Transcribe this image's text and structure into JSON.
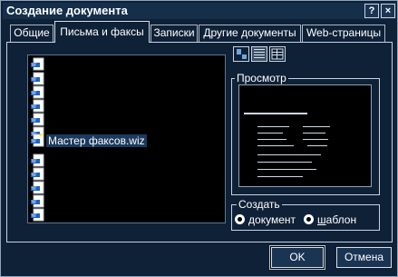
{
  "window": {
    "title": "Создание документа",
    "help_label": "?",
    "close_label": "×"
  },
  "tabs": [
    {
      "label": "Общие"
    },
    {
      "label": "Письма и факсы"
    },
    {
      "label": "Записки"
    },
    {
      "label": "Другие документы"
    },
    {
      "label": "Web-страницы"
    }
  ],
  "file_list": {
    "items": [
      {
        "label": ""
      },
      {
        "label": ""
      },
      {
        "label": ""
      },
      {
        "label": ""
      },
      {
        "label": ""
      },
      {
        "label": ""
      },
      {
        "label": "Мастер факсов.wiz",
        "selected": true
      },
      {
        "label": ""
      },
      {
        "label": ""
      },
      {
        "label": ""
      },
      {
        "label": ""
      },
      {
        "label": ""
      }
    ]
  },
  "view_buttons": [
    {
      "icon": "large-icons-icon",
      "active": false
    },
    {
      "icon": "list-icon",
      "active": true
    },
    {
      "icon": "details-icon",
      "active": false
    }
  ],
  "preview": {
    "label": "Просмотр"
  },
  "create": {
    "label": "Создать",
    "option_document": {
      "accel": "д",
      "rest": "окумент"
    },
    "option_template": {
      "accel": "ш",
      "rest": "аблон"
    }
  },
  "buttons": {
    "ok": "OK",
    "cancel": "Отмена"
  }
}
